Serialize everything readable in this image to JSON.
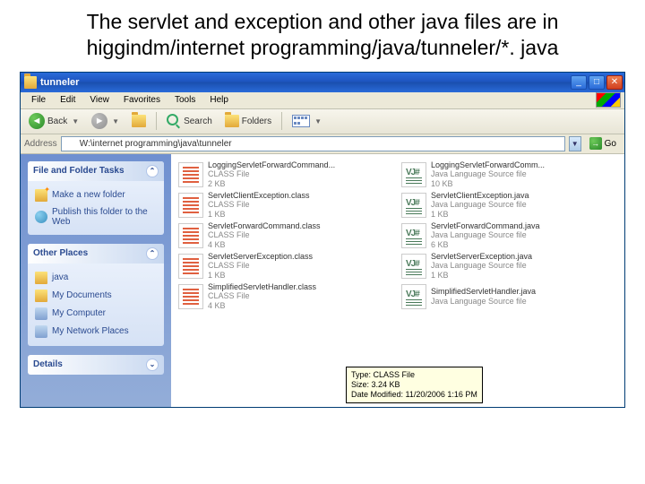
{
  "slide": {
    "title": "The servlet and exception and other java files are in higgindm/internet programming/java/tunneler/*. java"
  },
  "window": {
    "title": "tunneler"
  },
  "menubar": {
    "file": "File",
    "edit": "Edit",
    "view": "View",
    "favorites": "Favorites",
    "tools": "Tools",
    "help": "Help"
  },
  "toolbar": {
    "back": "Back",
    "search": "Search",
    "folders": "Folders"
  },
  "addressbar": {
    "label": "Address",
    "path": "W:\\internet programming\\java\\tunneler",
    "go": "Go"
  },
  "sidepane": {
    "panel1": {
      "title": "File and Folder Tasks",
      "task1": "Make a new folder",
      "task2": "Publish this folder to the Web"
    },
    "panel2": {
      "title": "Other Places",
      "p1": "java",
      "p2": "My Documents",
      "p3": "My Computer",
      "p4": "My Network Places"
    },
    "panel3": {
      "title": "Details"
    }
  },
  "files": [
    {
      "name": "LoggingServletForwardCommand...",
      "type": "CLASS File",
      "size": "2 KB",
      "kind": "class"
    },
    {
      "name": "LoggingServletForwardComm...",
      "type": "Java Language Source file",
      "size": "10 KB",
      "kind": "java"
    },
    {
      "name": "ServletClientException.class",
      "type": "CLASS File",
      "size": "1 KB",
      "kind": "class"
    },
    {
      "name": "ServletClientException.java",
      "type": "Java Language Source file",
      "size": "1 KB",
      "kind": "java"
    },
    {
      "name": "ServletForwardCommand.class",
      "type": "CLASS File",
      "size": "4 KB",
      "kind": "class"
    },
    {
      "name": "ServletForwardCommand.java",
      "type": "Java Language Source file",
      "size": "6 KB",
      "kind": "java"
    },
    {
      "name": "ServletServerException.class",
      "type": "CLASS File",
      "size": "1 KB",
      "kind": "class"
    },
    {
      "name": "ServletServerException.java",
      "type": "Java Language Source file",
      "size": "1 KB",
      "kind": "java"
    },
    {
      "name": "SimplifiedServletHandler.class",
      "type": "CLASS File",
      "size": "4 KB",
      "kind": "class"
    },
    {
      "name": "SimplifiedServletHandler.java",
      "type": "Java Language Source file",
      "size": "",
      "kind": "java"
    }
  ],
  "tooltip": {
    "l1": "Type: CLASS File",
    "l2": "Size: 3.24 KB",
    "l3": "Date Modified: 11/20/2006 1:16 PM"
  }
}
